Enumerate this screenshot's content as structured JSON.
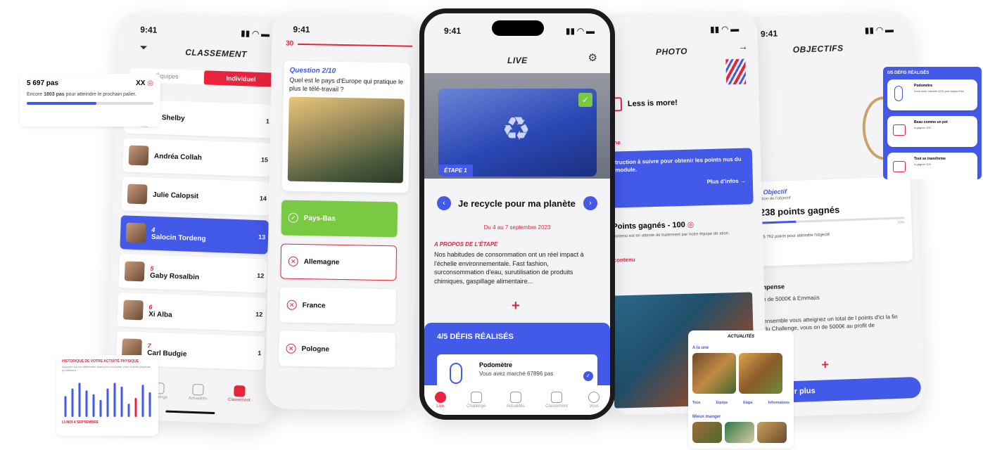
{
  "steps_card": {
    "steps": "5 697 pas",
    "xx": "XX",
    "line1": "Encore ",
    "highlight": "1803 pas",
    "line2": " pour atteindre le prochain palier.",
    "progress": 0.55
  },
  "classement": {
    "time": "9:41",
    "title": "CLASSEMENT",
    "tab_teams": "Équipes",
    "tab_individual": "Individuel",
    "rows": [
      {
        "rank": "",
        "name": "n Shelby",
        "pts": "1"
      },
      {
        "rank": "",
        "name": "Andréa Collah",
        "pts": "15"
      },
      {
        "rank": "",
        "name": "Julie Calopsit",
        "pts": "14"
      },
      {
        "rank": "4",
        "name": "Salocin Tordeng",
        "pts": "13"
      },
      {
        "rank": "5",
        "name": "Gaby Rosalbin",
        "pts": "12"
      },
      {
        "rank": "6",
        "name": "Xi Alba",
        "pts": "12"
      },
      {
        "rank": "7",
        "name": "Carl Budgie",
        "pts": "1"
      }
    ],
    "tabs": [
      "Challenge",
      "Actualités",
      "Classement"
    ]
  },
  "activity_card": {
    "title": "HISTORIQUE DE VOTRE ACTIVITÉ PHYSIQUE",
    "subtitle": "Appuyez sur les différentes dates pour consulter votre activité physique quotidienne",
    "footer": "LUNDI 4 SEPTEMBRE",
    "bars": [
      0.55,
      0.75,
      0.9,
      0.7,
      0.6,
      0.45,
      0.75,
      0.9,
      0.8,
      0.35,
      0.5,
      0.85,
      0.65
    ]
  },
  "quiz": {
    "time": "9:41",
    "timer": "30",
    "question_num": "Question 2/10",
    "question": "Quel est le pays d'Europe qui pratique le plus le télé-travail ?",
    "answers": [
      "Pays-Bas",
      "Allemagne",
      "France",
      "Pologne"
    ]
  },
  "live": {
    "time": "9:41",
    "title": "LIVE",
    "etape": "ÉTAPE 1",
    "step_title": "Je recycle pour ma planète",
    "dates": "Du 4 au 7 septembre 2023",
    "about_label": "A PROPOS DE L'ÉTAPE",
    "about_text": "Nos habitudes de consommation ont un réel impact à l'échelle environnementale. Fast fashion, surconsommation d'eau, surutilisation de produits chimiques, gaspillage alimentaire...",
    "defis_label": "4/5  DÉFIS RÉALISÉS",
    "defi_title": "Podomètre",
    "defi_text": "Vous avez marché 67896 pas",
    "tabs": [
      "Live",
      "Challenge",
      "Actualités",
      "Classement",
      "Vous"
    ]
  },
  "photo": {
    "title": "PHOTO",
    "less_is_more": "Less is more!",
    "consigne": "igne",
    "instruction": "truction à suivre pour obtenir les points nus du module.",
    "plus_infos": "Plus d'infos →",
    "points": "Points gagnés - 100",
    "points_note": "contenu est en attente de traitement par notre équipe de ation.",
    "contenu": "contenu"
  },
  "actualites": {
    "title": "ACTUALITÉS",
    "a_la_une": "A la une",
    "filters": [
      "Tous",
      "Equipe",
      "Etape",
      "Informations"
    ],
    "mieux_manger": "Mieux manger"
  },
  "objectifs": {
    "time": "9:41",
    "title": "OBJECTIFS",
    "objectif_label": "Objectif",
    "objectif_desc": "ption de l'objectif",
    "points": "238 points gagnés",
    "pct": "10%",
    "remaining": "25 762 points pour atteindre l'objectif",
    "pense_label": "npense",
    "pense_text": "n de 5000€ à Emmaüs",
    "pense_body": "ensemble vous atteignez un total de l points d'ici la fin du Challenge, vous on de 5000€ au profit de",
    "en_savoir": "n savoir plus"
  },
  "defis_panel": {
    "title": "0/5 DÉFIS RÉALISÉS",
    "items": [
      {
        "title": "Podomètre",
        "text": "Vous avez marché 4291 pas aujourd'hui"
      },
      {
        "title": "Beau comme un pot",
        "text": "A gagner 100"
      },
      {
        "title": "Tout se transforme",
        "text": "A gagner 100"
      }
    ]
  },
  "colors": {
    "accent": "#4359e8",
    "red": "#e8233b",
    "green": "#7ac943"
  }
}
